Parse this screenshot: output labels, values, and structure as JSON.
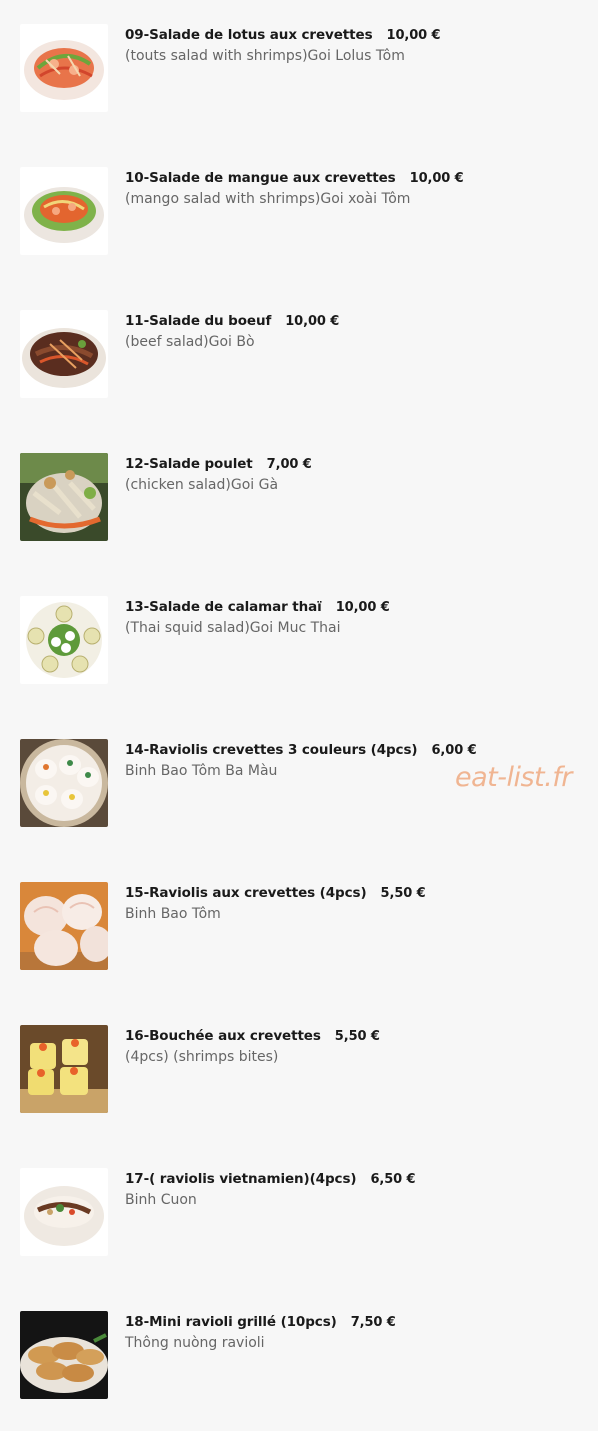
{
  "watermark": "eat-list.fr",
  "items": [
    {
      "title": "09-Salade de lotus aux crevettes",
      "price": "10,00 €",
      "desc": "(touts salad with shrimps)Goi Lolus Tôm"
    },
    {
      "title": "10-Salade de mangue aux crevettes",
      "price": "10,00 €",
      "desc": "(mango salad with shrimps)Goi xoài Tôm"
    },
    {
      "title": "11-Salade du boeuf",
      "price": "10,00 €",
      "desc": "(beef salad)Goi Bò"
    },
    {
      "title": "12-Salade poulet",
      "price": "7,00 €",
      "desc": "(chicken salad)Goi Gà"
    },
    {
      "title": "13-Salade de calamar thaï",
      "price": "10,00 €",
      "desc": "(Thai squid salad)Goi Muc Thai"
    },
    {
      "title": "14-Raviolis crevettes 3 couleurs (4pcs)",
      "price": "6,00 €",
      "desc": "Binh Bao Tôm Ba Màu"
    },
    {
      "title": "15-Raviolis aux crevettes (4pcs)",
      "price": "5,50 €",
      "desc": "Binh Bao Tôm"
    },
    {
      "title": "16-Bouchée aux crevettes",
      "price": "5,50 €",
      "desc": "(4pcs) (shrimps bites)"
    },
    {
      "title": "17-( raviolis vietnamien)(4pcs)",
      "price": "6,50 €",
      "desc": "Binh Cuon"
    },
    {
      "title": "18-Mini ravioli grillé (10pcs)",
      "price": "7,50 €",
      "desc": "Thông nuòng ravioli"
    }
  ],
  "colors": {
    "background": "#f7f7f7",
    "title": "#1a1a1a",
    "description": "#666666",
    "watermark": "#f0b592"
  }
}
